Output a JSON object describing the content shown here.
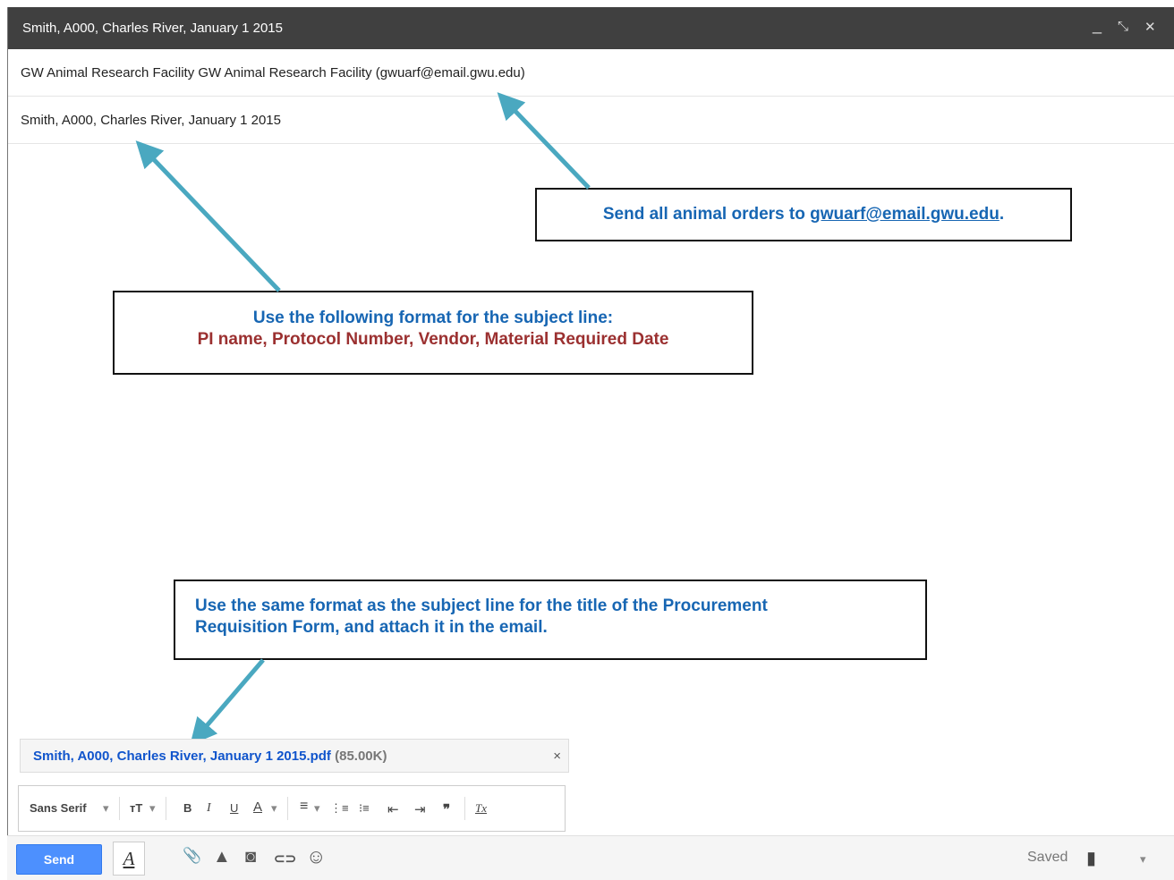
{
  "window": {
    "title": "Smith, A000, Charles River, January 1 2015",
    "minimize": "_",
    "popout": "⤡",
    "close": "✕"
  },
  "compose": {
    "to": "GW Animal Research Facility GW Animal Research Facility (gwuarf@email.gwu.edu)",
    "subject": "Smith, A000, Charles River, January 1 2015"
  },
  "callouts": {
    "email": {
      "text": "Send all animal orders to ",
      "link": "gwuarf@email.gwu.edu",
      "end": "."
    },
    "subject": {
      "line1": "Use the following format for the subject line:",
      "line2": "PI name, Protocol Number, Vendor, Material Required Date"
    },
    "attachment": {
      "line1": "Use the same format as the subject line for the title of the Procurement",
      "line2": "Requisition Form, and attach it in the email."
    }
  },
  "attachment": {
    "name": "Smith, A000, Charles River, January 1 2015.pdf",
    "size": "(85.00K)",
    "remove": "×"
  },
  "format_toolbar": {
    "font": "Sans Serif",
    "size": "тT",
    "bold": "B",
    "italic": "I",
    "underline": "U",
    "text_color": "A",
    "align": "≡",
    "numbered": "⋮≡",
    "bulleted": "⁝≡",
    "indent_less": "⇤",
    "indent_more": "⇥",
    "quote": "❞",
    "clear": "Tx",
    "caret": "▾"
  },
  "bottom": {
    "send": "Send",
    "format": "A",
    "attach_icon": "📎",
    "drive_icon": "▲",
    "photo_icon": "◙",
    "link_icon": "⊂⊃",
    "emoji_icon": "☺",
    "saved": "Saved",
    "trash_icon": "▮",
    "more_icon": "▾"
  }
}
